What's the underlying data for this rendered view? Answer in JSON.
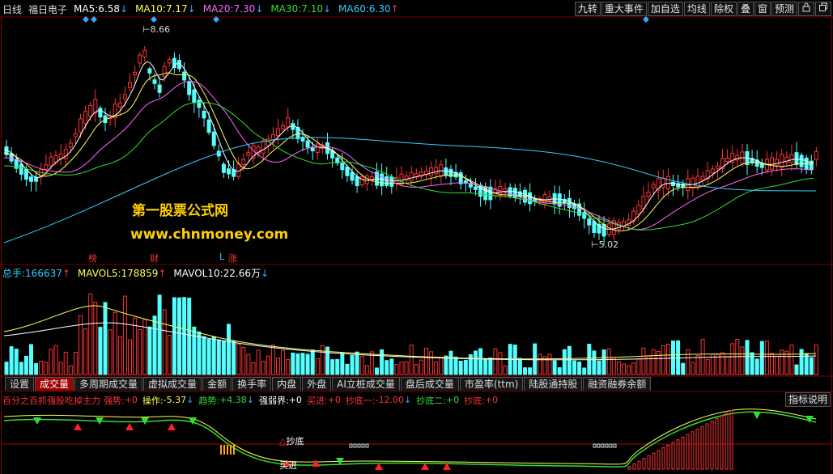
{
  "header": {
    "period": "日线",
    "stock_name": "福日电子",
    "ma": [
      {
        "label": "MA5:",
        "value": "6.58",
        "arrow": "↓",
        "color": "#ffffff"
      },
      {
        "label": "MA10:",
        "value": "7.17",
        "arrow": "↓",
        "color": "#ffff55"
      },
      {
        "label": "MA20:",
        "value": "7.30",
        "arrow": "↓",
        "color": "#ff66ff"
      },
      {
        "label": "MA30:",
        "value": "7.10",
        "arrow": "↓",
        "color": "#33dd33"
      },
      {
        "label": "MA60:",
        "value": "6.30",
        "arrow": "↑",
        "color": "#33ccff"
      }
    ]
  },
  "toolbar": {
    "jiuzhuan": "九转",
    "major_events": "重大事件",
    "add_watch": "加自选",
    "avg_line": "均线",
    "exclude_rights": "除权",
    "overlay": "叠",
    "window": "窗",
    "alert": "预测",
    "lock_icon": "lock-icon",
    "restore_icon": "restore-icon"
  },
  "price_chart": {
    "high_label": "8.66",
    "low_label": "5.02",
    "event_markers": [
      "榜",
      "财",
      "L",
      "涨"
    ],
    "watermark_title": "第一股票公式网",
    "watermark_url": "www.chnmoney.com"
  },
  "volume_panel": {
    "items": [
      {
        "label": "总手:",
        "value": "166637",
        "arrow": "↑",
        "color": "#33ccff"
      },
      {
        "label": "MAVOL5:",
        "value": "178859",
        "arrow": "↑",
        "color": "#ffff55"
      },
      {
        "label": "MAVOL10:",
        "value": "22.66万",
        "arrow": "↓",
        "color": "#ffffff"
      }
    ]
  },
  "tabs": [
    {
      "label": "设置",
      "active": false
    },
    {
      "label": "成交量",
      "active": true
    },
    {
      "label": "多周期成交量",
      "active": false
    },
    {
      "label": "虚拟成交量",
      "active": false
    },
    {
      "label": "金额",
      "active": false
    },
    {
      "label": "换手率",
      "active": false
    },
    {
      "label": "内盘",
      "active": false
    },
    {
      "label": "外盘",
      "active": false
    },
    {
      "label": "AI立桩成交量",
      "active": false
    },
    {
      "label": "盘后成交量",
      "active": false
    },
    {
      "label": "市盈率(ttm)",
      "active": false
    },
    {
      "label": "陆股通持股",
      "active": false
    },
    {
      "label": "融资融券余额",
      "active": false
    }
  ],
  "indicator": {
    "name": "百分之百抓强股吃掉主力",
    "fields": [
      {
        "label": "强势:",
        "value": "+0",
        "color": "#ff3333"
      },
      {
        "label": "操作:",
        "value": "-5.37",
        "arrow": "↓",
        "color": "#ffff55"
      },
      {
        "label": "趋势:",
        "value": "+4.38",
        "arrow": "↓",
        "color": "#33dd33"
      },
      {
        "label": "强弱界:",
        "value": "+0",
        "color": "#ffffff"
      },
      {
        "label": "买进:",
        "value": "+0",
        "color": "#ff3333"
      },
      {
        "label": "抄底一:",
        "value": "-12.00",
        "arrow": "↓",
        "color": "#ff3333"
      },
      {
        "label": "抄底二:",
        "value": "+0",
        "color": "#33dd33"
      },
      {
        "label": "抄底:",
        "value": "+0",
        "color": "#ff3333"
      }
    ],
    "help_button": "指标说明",
    "annot_bottom": "抄底",
    "annot_buy": "买进"
  }
}
